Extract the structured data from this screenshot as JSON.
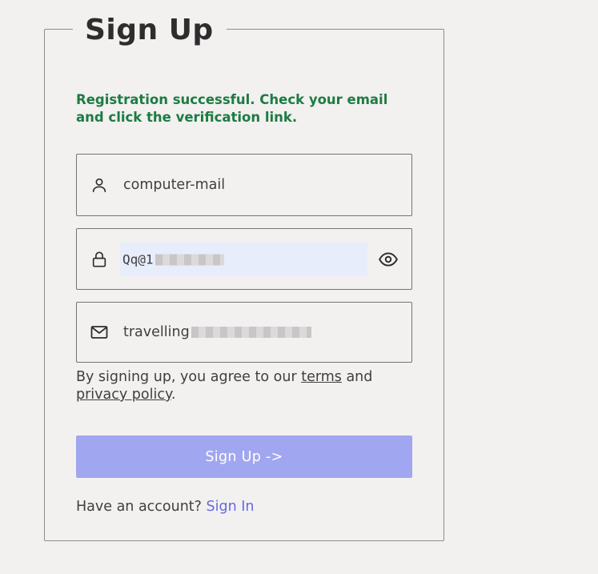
{
  "form": {
    "title": "Sign Up",
    "success_message": "Registration successful. Check your email and click the verification link.",
    "username": {
      "value": "computer-mail",
      "icon": "user-icon"
    },
    "password": {
      "value_visible": "Qq@1",
      "icon": "lock-icon",
      "toggle_icon": "eye-icon"
    },
    "email": {
      "value_visible": "travelling",
      "icon": "mail-icon"
    },
    "terms": {
      "prefix": "By signing up, you agree to our ",
      "terms_link": "terms",
      "middle": " and",
      "privacy_link": "privacy policy",
      "suffix": "."
    },
    "submit_label": "Sign Up ->",
    "account_prompt": "Have an account? ",
    "signin_link": "Sign In"
  },
  "colors": {
    "background": "#f3f0f0",
    "success": "#1c7c43",
    "button": "#a1a6f0",
    "link": "#6469e0",
    "autofill": "#e8edfb"
  }
}
